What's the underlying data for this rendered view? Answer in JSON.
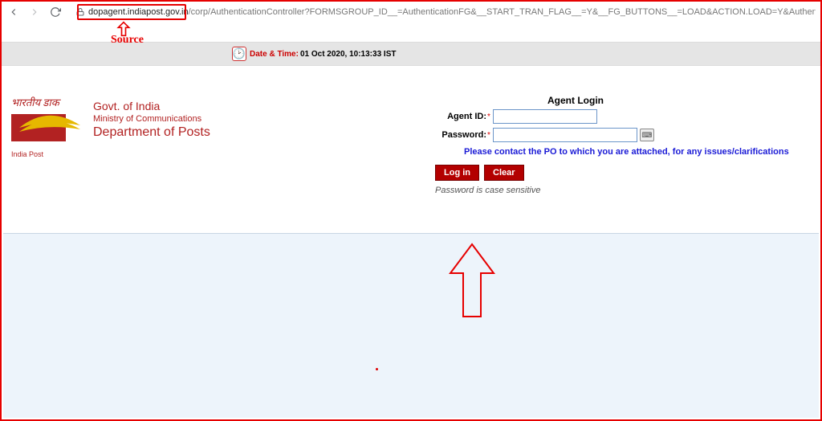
{
  "browser": {
    "url_host": "dopagent.indiapost.gov.in",
    "url_path": "/corp/AuthenticationController?FORMSGROUP_ID__=AuthenticationFG&__START_TRAN_FLAG__=Y&__FG_BUTTONS__=LOAD&ACTION.LOAD=Y&AuthenticationFG.L"
  },
  "annotation": {
    "source_label": "Source"
  },
  "datetime": {
    "label": "Date & Time:",
    "value": "01 Oct 2020, 10:13:33 IST"
  },
  "org": {
    "script": "भारतीय डाक",
    "india_post": "India Post",
    "line1": "Govt. of India",
    "line2": "Ministry of Communications",
    "line3": "Department of Posts"
  },
  "login": {
    "title": "Agent Login",
    "agent_id_label": "Agent ID:",
    "password_label": "Password:",
    "notice": "Please contact the PO to which you are attached, for any issues/clarifications",
    "login_btn": "Log in",
    "clear_btn": "Clear",
    "pw_note": "Password is case sensitive"
  }
}
